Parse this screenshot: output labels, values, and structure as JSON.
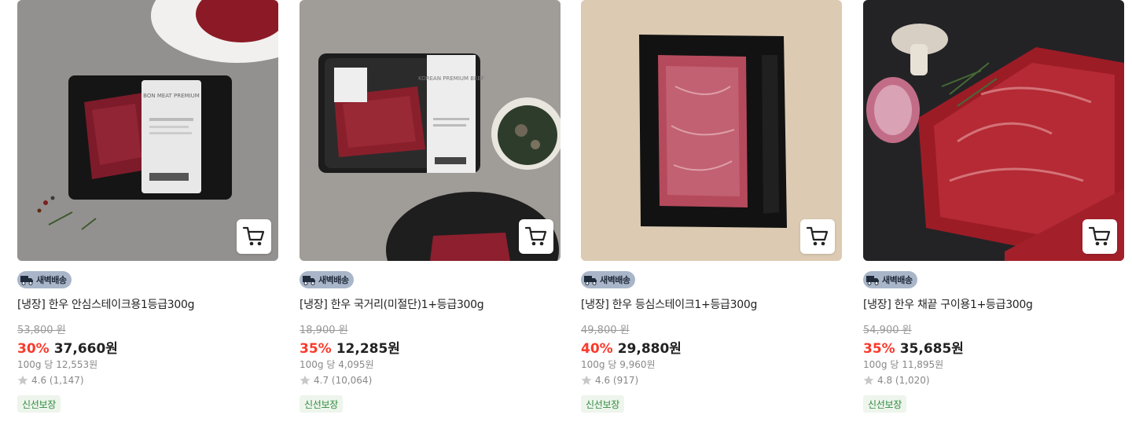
{
  "products": [
    {
      "badge": "새벽배송",
      "title": "[냉장] 한우 안심스테이크용1등급300g",
      "original_price": "53,800 원",
      "discount": "30%",
      "sale_price": "37,660원",
      "unit_price": "100g 당 12,553원",
      "rating": "4.6 (1,147)",
      "tag": "신선보장",
      "package_label": "BON MEAT PREMIUM"
    },
    {
      "badge": "새벽배송",
      "title": "[냉장] 한우 국거리(미절단)1+등급300g",
      "original_price": "18,900 원",
      "discount": "35%",
      "sale_price": "12,285원",
      "unit_price": "100g 당 4,095원",
      "rating": "4.7 (10,064)",
      "tag": "신선보장",
      "package_label": "KOREAN PREMIUM BEEF"
    },
    {
      "badge": "새벽배송",
      "title": "[냉장] 한우 등심스테이크1+등급300g",
      "original_price": "49,800 원",
      "discount": "40%",
      "sale_price": "29,880원",
      "unit_price": "100g 당 9,960원",
      "rating": "4.6 (917)",
      "tag": "신선보장"
    },
    {
      "badge": "새벽배송",
      "title": "[냉장] 한우 채끝 구이용1+등급300g",
      "original_price": "54,900 원",
      "discount": "35%",
      "sale_price": "35,685원",
      "unit_price": "100g 당 11,895원",
      "rating": "4.8 (1,020)",
      "tag": "신선보장"
    }
  ],
  "colors": {
    "discount": "#fa3a2c",
    "badge_bg": "#a9b6c9",
    "tag_bg": "#eef5ec",
    "tag_text": "#2f8a3f"
  },
  "icons": {
    "cart": "cart-icon",
    "badge": "truck-icon",
    "rating": "star-icon"
  }
}
